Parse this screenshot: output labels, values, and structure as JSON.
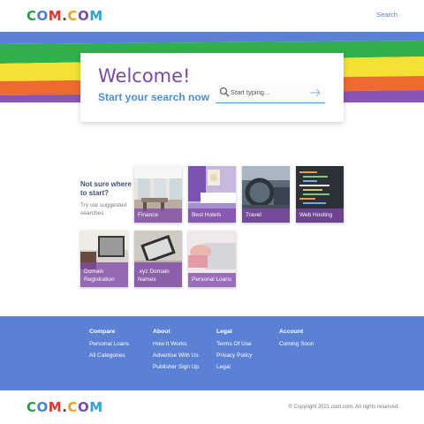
{
  "header": {
    "logo_parts": [
      "C",
      "O",
      "M",
      ".",
      "C",
      "O",
      "M"
    ],
    "logo_colors": [
      "#2e9a47",
      "#4a7fd6",
      "#e4342f",
      "#444444",
      "#f0a21f",
      "#7b4fa8",
      "#2fa3d8"
    ],
    "search_link": "Search"
  },
  "rainbow_colors": [
    "#5b81d4",
    "#2fb04c",
    "#f4e133",
    "#ef6a31",
    "#8a54b7"
  ],
  "welcome": {
    "title": "Welcome!",
    "subtitle": "Start your search now",
    "search_placeholder": "Start typing..."
  },
  "suggestions": {
    "title": "Not sure where to start?",
    "subtitle": "Try our suggested searches",
    "tiles": [
      {
        "label": "Finance",
        "icon": "office-photo"
      },
      {
        "label": "Best Hotels",
        "icon": "hotel-room-photo"
      },
      {
        "label": "Travel",
        "icon": "car-interior-photo"
      },
      {
        "label": "Web Hosting",
        "icon": "code-screen-photo"
      },
      {
        "label": "Domain Registration",
        "icon": "laptop-desk-photo"
      },
      {
        "label": ".xyz Domain Names",
        "icon": "laptop-typing-photo"
      },
      {
        "label": "Personal Loans",
        "icon": "hands-keyboard-photo"
      }
    ]
  },
  "footer": {
    "columns": [
      {
        "heading": "Compare",
        "links": [
          "Personal Loans",
          "All Categories"
        ]
      },
      {
        "heading": "About",
        "links": [
          "How It Works",
          "Advertise With Us",
          "Publisher Sign Up"
        ]
      },
      {
        "heading": "Legal",
        "links": [
          "Terms Of Use",
          "Privacy Policy",
          "Legal"
        ]
      },
      {
        "heading": "Account",
        "links": [
          "Coming Soon"
        ]
      }
    ],
    "copyright": "© Copyright 2021 com.com. All rights reserved."
  }
}
